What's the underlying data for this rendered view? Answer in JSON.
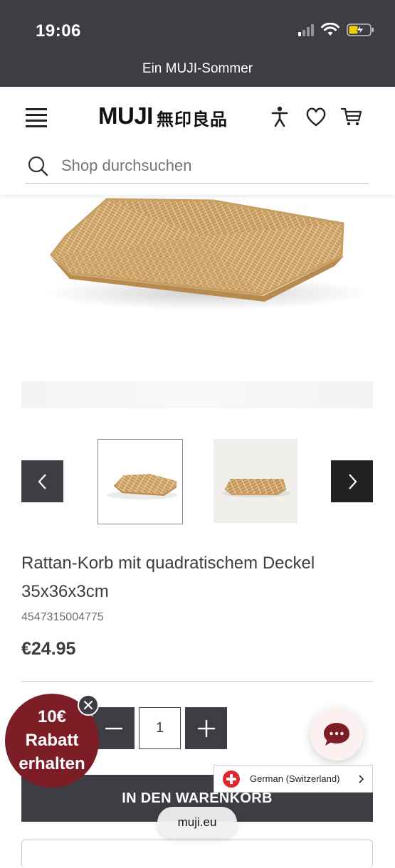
{
  "status_bar": {
    "time": "19:06"
  },
  "promo_banner": {
    "text": "Ein MUJI-Sommer"
  },
  "header": {
    "logo_text": "MUJI",
    "logo_kanji": "無印良品",
    "search_placeholder": "Shop durchsuchen",
    "icons": [
      "menu-icon",
      "accessibility-icon",
      "heart-icon",
      "cart-icon",
      "search-icon"
    ]
  },
  "product": {
    "title": "Rattan-Korb mit quadratischem Deckel 35x36x3cm",
    "sku": "4547315004775",
    "price": "€24.95",
    "quantity": "1",
    "add_to_cart_label": "IN DEN WARENKORB"
  },
  "quantity": {
    "minus_label": "−",
    "plus_label": "+"
  },
  "carousel": {
    "prev_icon": "chevron-left-icon",
    "next_icon": "chevron-right-icon",
    "thumbnails": 2
  },
  "discount_popup": {
    "line1": "10€",
    "line2": "Rabatt",
    "line3": "erhalten"
  },
  "language_selector": {
    "label": "German (Switzerland)",
    "flag_icon": "swiss-flag-icon"
  },
  "browser": {
    "url": "muji.eu"
  },
  "colors": {
    "dark": "#3d3d43",
    "discount": "#7d1d25",
    "chat_bg": "#fdf0f1",
    "chat_bubble": "#7d1d25"
  }
}
